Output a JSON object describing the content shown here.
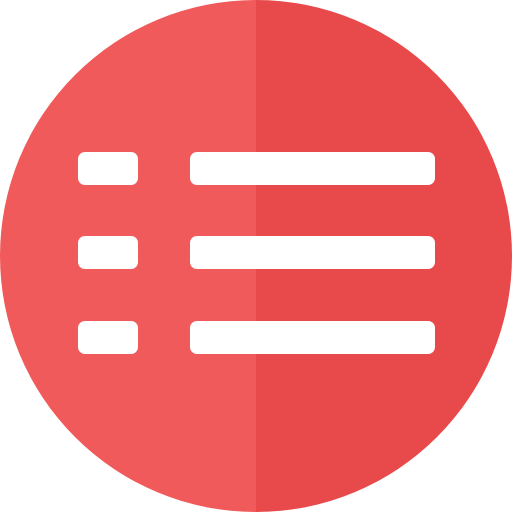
{
  "icon": {
    "name": "list-icon",
    "colors": {
      "circle_left": "#F05A5B",
      "circle_right": "#E84A4B",
      "marks": "#FFFFFF"
    },
    "rows": 3
  }
}
